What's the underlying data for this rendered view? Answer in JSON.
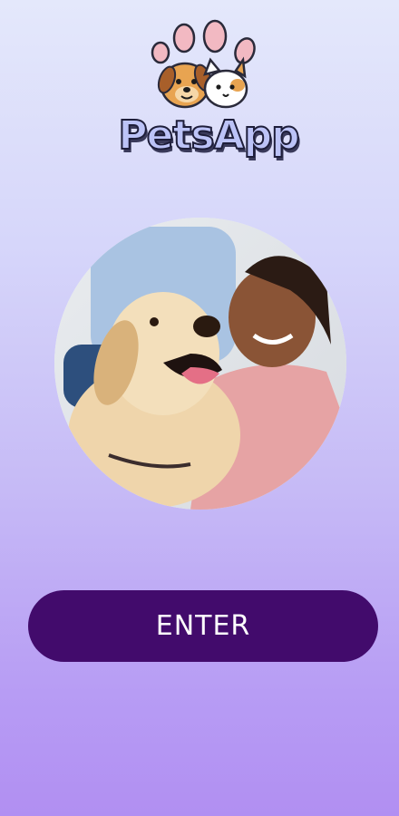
{
  "app": {
    "name": "PetsApp"
  },
  "hero": {
    "image": "girl-hugging-golden-retriever-photo"
  },
  "actions": {
    "enter_label": "ENTER"
  },
  "colors": {
    "button": "#420b6c",
    "button_text": "#ffffff",
    "logo_text": "#bcc3f7"
  }
}
